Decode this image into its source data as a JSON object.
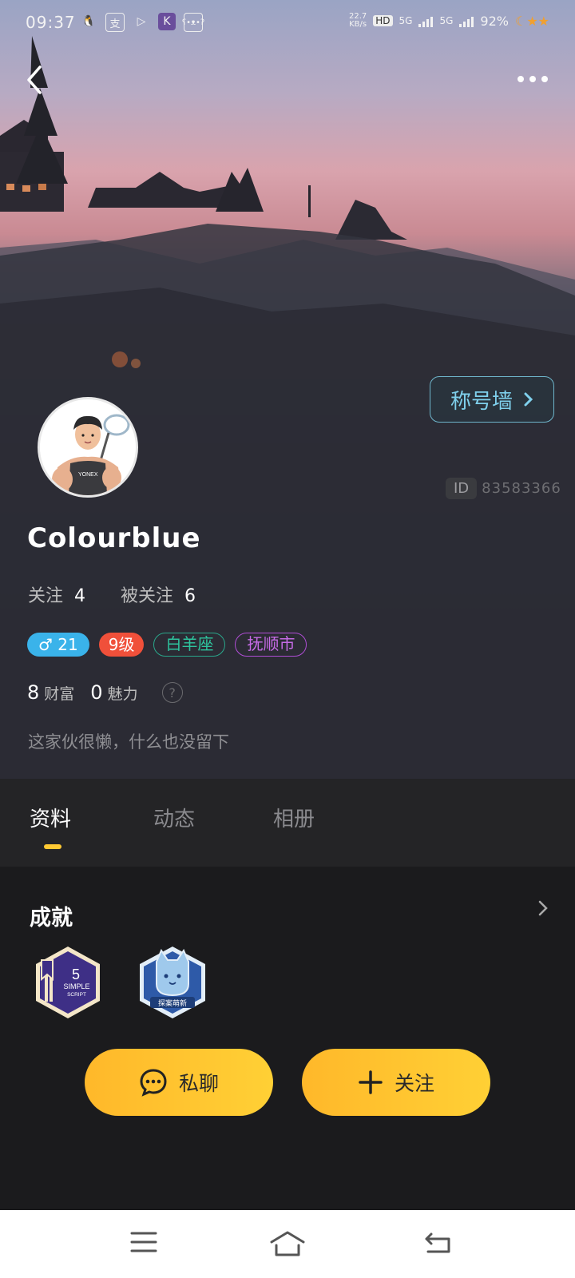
{
  "status_bar": {
    "time": "09:37",
    "net_speed": "22.7",
    "net_unit": "KB/s",
    "hd": "HD",
    "sim1": "5G",
    "sim2": "5G",
    "battery": "92%"
  },
  "profile": {
    "title_wall_label": "称号墙",
    "id_label": "ID",
    "id_value": "83583366",
    "username": "Colourblue",
    "following_label": "关注",
    "following_count": "4",
    "followers_label": "被关注",
    "followers_count": "6",
    "tags": {
      "gender_age": "♂ 21",
      "level": "9级",
      "zodiac": "白羊座",
      "city": "抚顺市"
    },
    "wealth_value": "8",
    "wealth_label": "财富",
    "charm_value": "0",
    "charm_label": "魅力",
    "help_symbol": "?",
    "bio": "这家伙很懒，什么也没留下"
  },
  "tabs": [
    {
      "label": "资料",
      "active": true
    },
    {
      "label": "动态",
      "active": false
    },
    {
      "label": "相册",
      "active": false
    }
  ],
  "achievements": {
    "title": "成就",
    "badges": [
      {
        "icon": "book-badge-icon",
        "number": "5",
        "line1": "SIMPLE",
        "line2": "SCRIPT"
      },
      {
        "icon": "cat-badge-icon",
        "text": "探案萌新"
      }
    ]
  },
  "actions": {
    "chat_label": "私聊",
    "follow_label": "关注"
  },
  "colors": {
    "accent_yellow": "#ffc933",
    "title_wall_cyan": "#7fd0ec",
    "gender_blue": "#3ab3ea",
    "level_red": "#f0503a",
    "zodiac_green": "#2ec49e",
    "city_purple": "#c66be6"
  }
}
